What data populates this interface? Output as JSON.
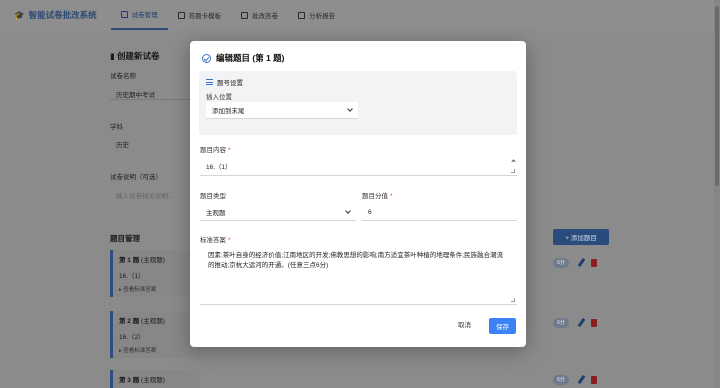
{
  "nav": {
    "brand": "智能试卷批改系统",
    "tabs": [
      {
        "label": "试卷管理",
        "active": true
      },
      {
        "label": "答题卡模板",
        "active": false
      },
      {
        "label": "批改答卷",
        "active": false
      },
      {
        "label": "分析报告",
        "active": false
      }
    ]
  },
  "page": {
    "create_title": "创建新试卷",
    "exam_name_label": "试卷名称",
    "exam_name_value": "历史期中考试",
    "subject_label": "学科",
    "subject_value": "历史",
    "desc_label": "试卷说明（可选）",
    "desc_placeholder": "输入试卷相关说明...",
    "questions_title": "题目管理",
    "add_question_label": "+ 添加题目",
    "questions": [
      {
        "num": "第 1 题",
        "type": "(主观题)",
        "content": "16.（1）",
        "link": "▸ 查看标准答案",
        "score": "6分"
      },
      {
        "num": "第 2 题",
        "type": "(主观题)",
        "content": "16.（2）",
        "link": "▸ 查看标准答案",
        "score": "6分"
      },
      {
        "num": "第 3 题",
        "type": "(主观题)",
        "content": "",
        "link": "",
        "score": "6分"
      }
    ]
  },
  "modal": {
    "title": "编辑题目 (第 1 题)",
    "section_title": "题号设置",
    "insert_label": "插入位置",
    "insert_value": "添加到末尾",
    "content_label": "题目内容",
    "content_value": "16.（1）",
    "type_label": "题目类型",
    "type_value": "主观题",
    "score_label": "题目分值",
    "score_value": "6",
    "answer_label": "标准答案",
    "answer_value": "因素:茶叶自身的经济价值;江南地区的开发;佛教思想的影响;南方适宜茶叶种植的地理条件;民族融合潮流的推动;京杭大运河的开通。(任意三点6分)",
    "cancel_label": "取消",
    "save_label": "保存"
  }
}
